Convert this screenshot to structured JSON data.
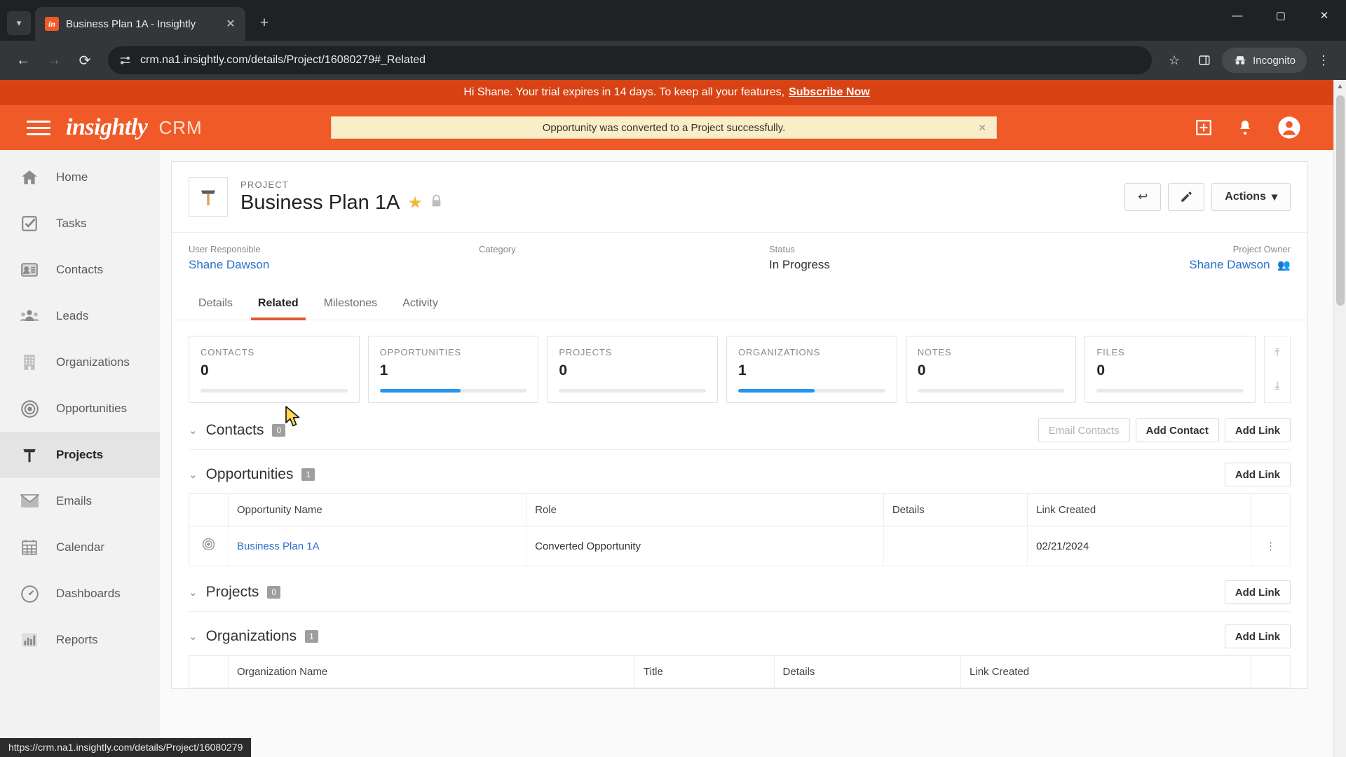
{
  "browser": {
    "tab": {
      "title": "Business Plan 1A - Insightly",
      "favicon_label": "in"
    },
    "new_tab_label": "+",
    "nav": {
      "back": "←",
      "forward": "→",
      "reload": "⟳"
    },
    "omnibox": {
      "url": "crm.na1.insightly.com/details/Project/16080279#_Related",
      "site_icon": "tune-icon"
    },
    "incognito_label": "Incognito",
    "window": {
      "minimize": "—",
      "maximize": "▢",
      "close": "✕"
    },
    "status_bar_url": "https://crm.na1.insightly.com/details/Project/16080279"
  },
  "trial_banner": {
    "text": "Hi Shane. Your trial expires in 14 days. To keep all your features,",
    "link": "Subscribe Now"
  },
  "app_header": {
    "logo": "insightly",
    "product": "CRM",
    "toast": "Opportunity was converted to a Project successfully.",
    "toast_close": "✕"
  },
  "sidebar": {
    "items": [
      {
        "label": "Home",
        "icon": "home-icon",
        "active": false
      },
      {
        "label": "Tasks",
        "icon": "checkbox-icon",
        "active": false
      },
      {
        "label": "Contacts",
        "icon": "contact-card-icon",
        "active": false
      },
      {
        "label": "Leads",
        "icon": "people-icon",
        "active": false
      },
      {
        "label": "Organizations",
        "icon": "building-icon",
        "active": false
      },
      {
        "label": "Opportunities",
        "icon": "target-icon",
        "active": false
      },
      {
        "label": "Projects",
        "icon": "hammer-icon",
        "active": true
      },
      {
        "label": "Emails",
        "icon": "envelope-icon",
        "active": false
      },
      {
        "label": "Calendar",
        "icon": "calendar-icon",
        "active": false
      },
      {
        "label": "Dashboards",
        "icon": "gauge-icon",
        "active": false
      },
      {
        "label": "Reports",
        "icon": "bar-chart-icon",
        "active": false
      }
    ]
  },
  "record": {
    "kind": "PROJECT",
    "title": "Business Plan 1A",
    "avatar_icon": "hammer-icon",
    "favorite_icon": "star-icon",
    "lock_icon": "lock-icon",
    "actions_label": "Actions",
    "back_btn_icon": "back-arrow-icon",
    "edit_btn_icon": "pencil-icon",
    "fields": [
      {
        "label": "User Responsible",
        "value": "Shane Dawson",
        "link": true
      },
      {
        "label": "Category",
        "value": "",
        "link": false
      },
      {
        "label": "Status",
        "value": "In Progress",
        "link": false
      },
      {
        "label": "Project Owner",
        "value": "Shane Dawson",
        "link": true
      }
    ]
  },
  "tabs": [
    {
      "label": "Details",
      "active": false
    },
    {
      "label": "Related",
      "active": true
    },
    {
      "label": "Milestones",
      "active": false
    },
    {
      "label": "Activity",
      "active": false
    }
  ],
  "metrics": [
    {
      "label": "CONTACTS",
      "value": "0",
      "progress": 0
    },
    {
      "label": "OPPORTUNITIES",
      "value": "1",
      "progress": 55
    },
    {
      "label": "PROJECTS",
      "value": "0",
      "progress": 0
    },
    {
      "label": "ORGANIZATIONS",
      "value": "1",
      "progress": 52
    },
    {
      "label": "NOTES",
      "value": "0",
      "progress": 0
    },
    {
      "label": "FILES",
      "value": "0",
      "progress": 0
    }
  ],
  "metric_nav": {
    "up": "⤒",
    "down": "⤓"
  },
  "sections": {
    "contacts": {
      "title": "Contacts",
      "count": "0",
      "buttons": [
        {
          "label": "Email Contacts",
          "disabled": true
        },
        {
          "label": "Add Contact",
          "disabled": false
        },
        {
          "label": "Add Link",
          "disabled": false
        }
      ]
    },
    "opportunities": {
      "title": "Opportunities",
      "count": "1",
      "buttons": [
        {
          "label": "Add Link",
          "disabled": false
        }
      ],
      "columns": [
        "Opportunity Name",
        "Role",
        "Details",
        "Link Created"
      ],
      "rows": [
        {
          "icon": "target-icon",
          "name": "Business Plan 1A",
          "role": "Converted Opportunity",
          "details": "",
          "link_created": "02/21/2024",
          "menu": "⋮"
        }
      ]
    },
    "projects": {
      "title": "Projects",
      "count": "0",
      "buttons": [
        {
          "label": "Add Link",
          "disabled": false
        }
      ]
    },
    "organizations": {
      "title": "Organizations",
      "count": "1",
      "buttons": [
        {
          "label": "Add Link",
          "disabled": false
        }
      ],
      "columns": [
        "Organization Name",
        "Title",
        "Details",
        "Link Created"
      ]
    }
  },
  "colors": {
    "brand_orange": "#f05a28",
    "banner_orange": "#d84315",
    "toast_bg": "#faeec8",
    "link_blue": "#2a6fc9",
    "progress_blue": "#2196f3",
    "tab_underline": "#e05a32"
  }
}
